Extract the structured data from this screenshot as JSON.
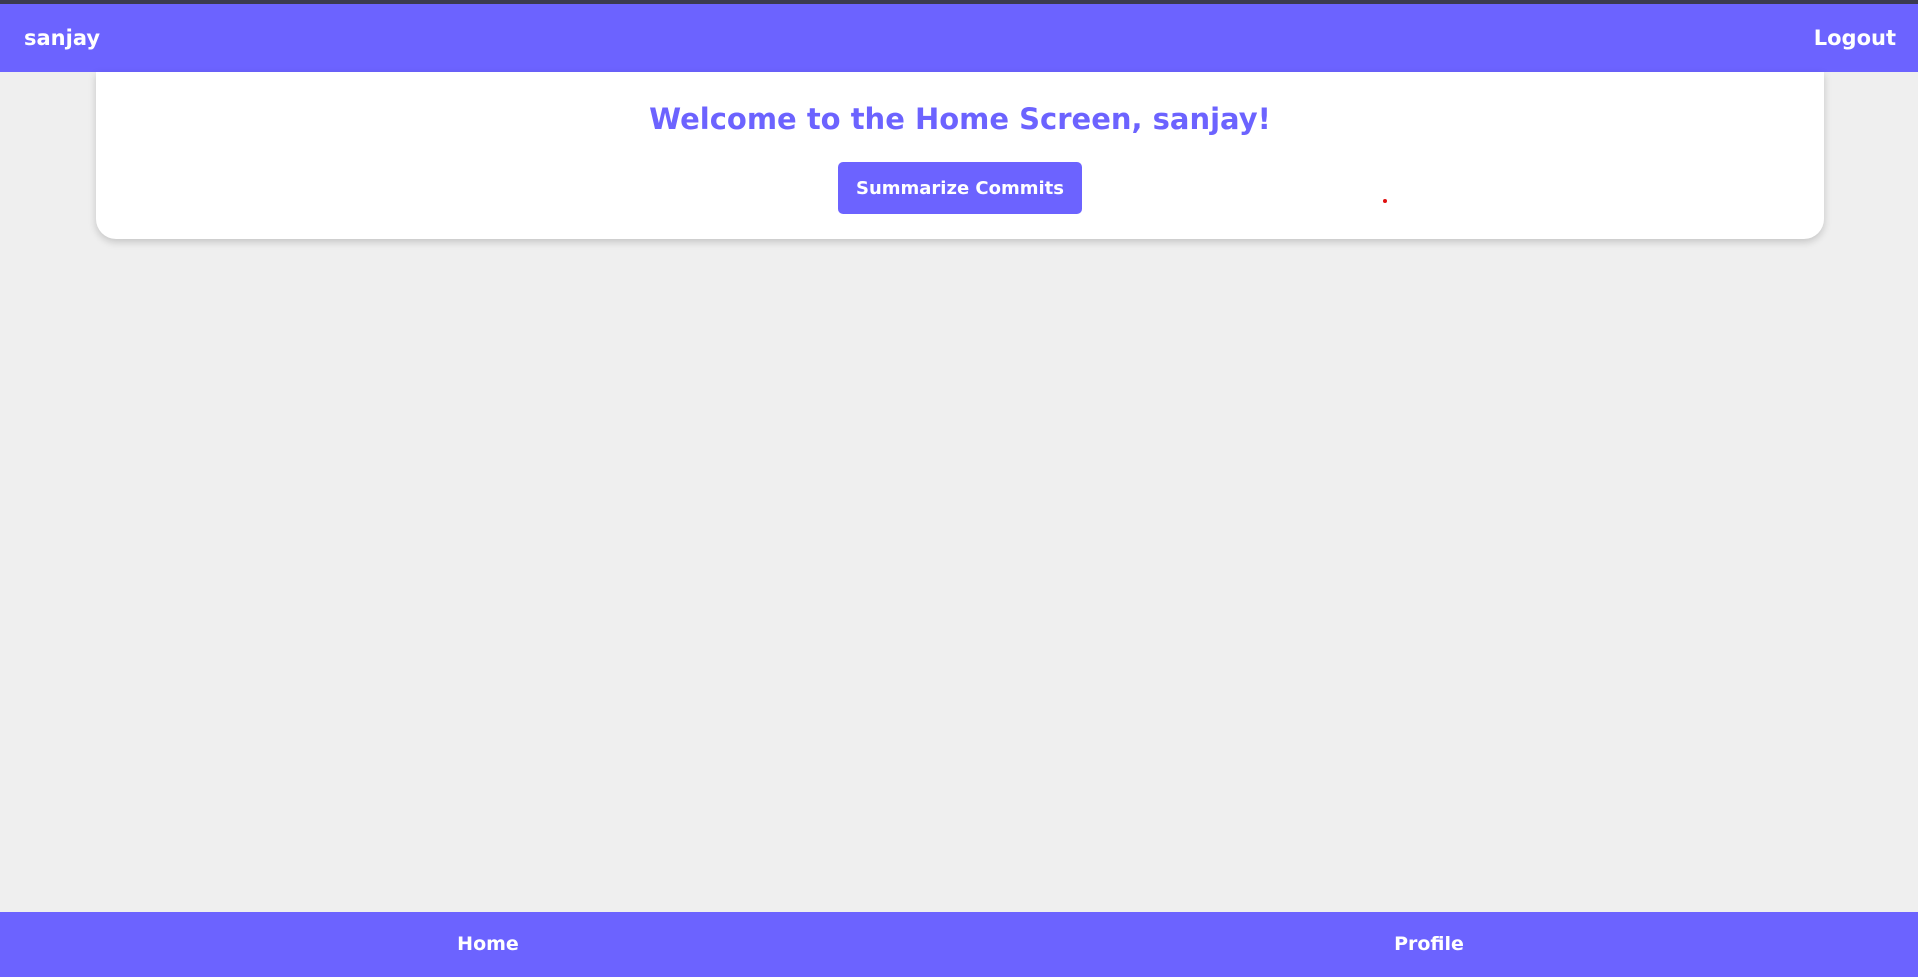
{
  "header": {
    "username": "sanjay",
    "logout_label": "Logout"
  },
  "main": {
    "welcome_title": "Welcome to the Home Screen, sanjay!",
    "summarize_label": "Summarize Commits"
  },
  "footer": {
    "home_label": "Home",
    "profile_label": "Profile"
  },
  "colors": {
    "accent": "#6c63ff",
    "background": "#efefef",
    "card": "#ffffff"
  }
}
